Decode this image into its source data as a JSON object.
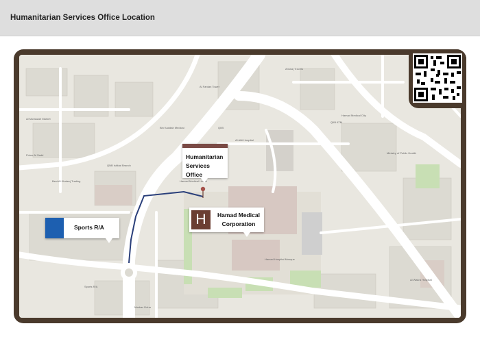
{
  "header": {
    "title": "Humanitarian Services Office Location"
  },
  "map": {
    "callouts": {
      "hso": {
        "line1": "Humanitarian",
        "line2": "Services Office"
      },
      "hmc": {
        "icon_letter": "H",
        "line1": "Hamad Medical",
        "line2": "Corporation"
      },
      "sports": {
        "label": "Sports R/A"
      }
    },
    "qr_code": "qr-code-icon",
    "pin": "location-pin-icon",
    "colors": {
      "frame": "#4a3a2c",
      "hso_bar": "#7a4a45",
      "hospital_icon": "#6b3e32",
      "sports_square": "#1d5fb0",
      "route": "#2a3f7a"
    }
  }
}
